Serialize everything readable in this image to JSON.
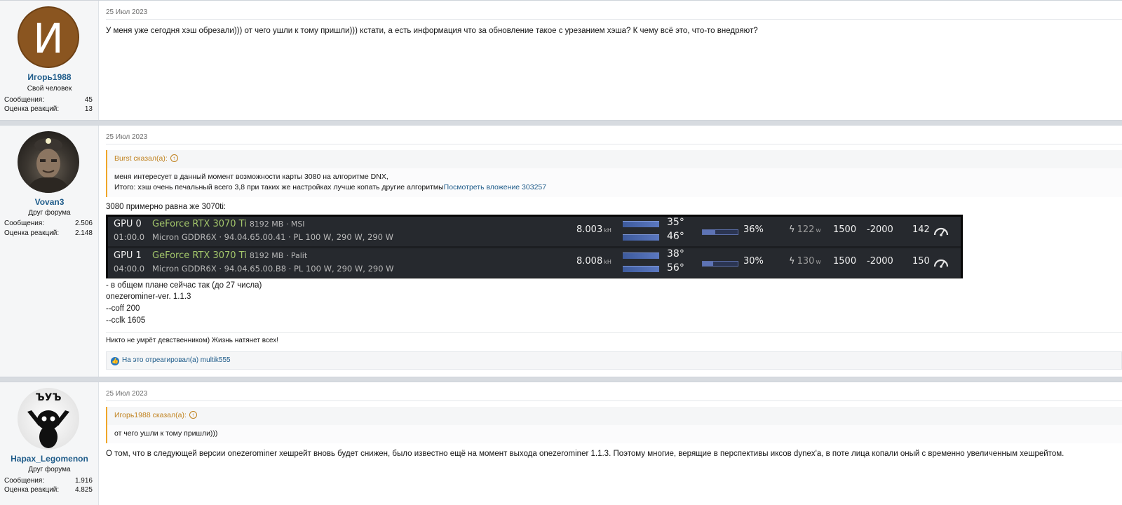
{
  "posts": [
    {
      "author": {
        "name": "Игорь1988",
        "title": "Свой человек",
        "avatar_letter": "И",
        "messages_label": "Сообщения:",
        "messages": "45",
        "reactions_label": "Оценка реакций:",
        "reactions": "13"
      },
      "date": "25 Июл 2023",
      "text": "У меня уже сегодня хэш обрезали))) от чего ушли к тому пришли))) кстати, а есть информация что за обновление такое с урезанием хэша? К чему всё это, что-то внедряют?"
    },
    {
      "author": {
        "name": "Vovan3",
        "title": "Друг форума",
        "messages_label": "Сообщения:",
        "messages": "2.506",
        "reactions_label": "Оценка реакций:",
        "reactions": "2.148"
      },
      "date": "25 Июл 2023",
      "quote": {
        "header": "Burst сказал(а):",
        "line1": "меня интересует в данный момент возможности карты 3080 на алгоритме DNX,",
        "line2": "Итого: хэш очень печальный всего 3,8 при таких же настройках лучше копать другие алгоритмы",
        "link": "Посмотреть вложение 303257"
      },
      "intro": "3080 примерно равна же 3070ti:",
      "gpus": [
        {
          "id": "GPU 0",
          "bus": "01:00.0",
          "model": "GeForce RTX 3070 Ti",
          "mem": "8192 MB · MSI",
          "sub": "Micron GDDR6X · 94.04.65.00.41 · PL 100 W, 290 W, 290 W",
          "hashrate": "8.003",
          "hash_unit": "kH",
          "temp_core": "35°",
          "temp_mem": "46°",
          "fan": "36%",
          "fan_value": 0.36,
          "power": "122",
          "power_unit": "w",
          "core_clock": "1500",
          "mem_clock": "-2000",
          "power_limit": "142",
          "icon": "gauge-icon"
        },
        {
          "id": "GPU 1",
          "bus": "04:00.0",
          "model": "GeForce RTX 3070 Ti",
          "mem": "8192 MB · Palit",
          "sub": "Micron GDDR6X · 94.04.65.00.B8 · PL 100 W, 290 W, 290 W",
          "hashrate": "8.008",
          "hash_unit": "kH",
          "temp_core": "38°",
          "temp_mem": "56°",
          "fan": "30%",
          "fan_value": 0.3,
          "power": "130",
          "power_unit": "w",
          "core_clock": "1500",
          "mem_clock": "-2000",
          "power_limit": "150",
          "icon": "gauge-icon"
        }
      ],
      "lines": [
        "- в общем плане сейчас так (до 27 числа)",
        "onezerominer-ver. 1.1.3",
        "--coff 200",
        "--cclk 1605"
      ],
      "signature": "Никто не умрёт девственником) Жизнь натянет всех!",
      "reactions_text": "На это отреагировал(а) multik555"
    },
    {
      "author": {
        "name": "Hapax_Legomenon",
        "title": "Друг форума",
        "avatar_text": "ЪУЪ",
        "messages_label": "Сообщения:",
        "messages": "1.916",
        "reactions_label": "Оценка реакций:",
        "reactions": "4.825"
      },
      "date": "25 Июл 2023",
      "quote": {
        "header": "Игорь1988 сказал(а):",
        "line1": "от чего ушли к тому пришли)))"
      },
      "text": "О том, что в следующей версии onezerominer хешрейт вновь будет снижен, было известно ещё на момент выхода onezerominer 1.1.3. Поэтому многие, верящие в перспективы иксов dynex'а, в поте лица копали оный с временно увеличенным хешрейтом."
    }
  ],
  "colors": {
    "username": "#1f5c8a",
    "quote_accent": "#f0a629",
    "gpu_model": "#a4c76b",
    "panel_bg": "#1c1e22"
  }
}
